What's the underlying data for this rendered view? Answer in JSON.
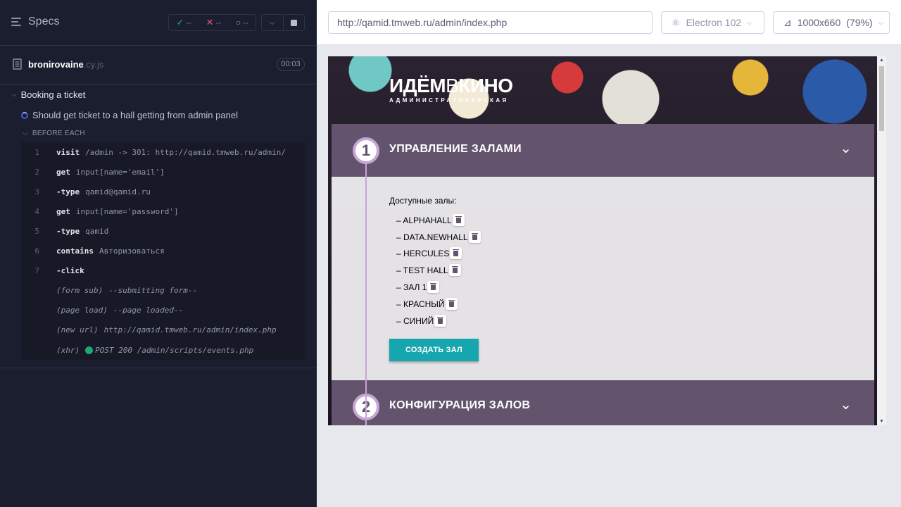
{
  "reporter": {
    "specs_label": "Specs",
    "stats": {
      "passed": "--",
      "failed": "--",
      "pending": "--"
    },
    "file": {
      "name": "bronirovaine",
      "ext": ".cy.js",
      "duration": "00:03"
    },
    "suite": "Booking a ticket",
    "test": "Should get ticket to a hall getting from admin panel",
    "hook": "BEFORE EACH",
    "commands": [
      {
        "num": "1",
        "name": "visit",
        "msg": "/admin -> 301: http://qamid.tmweb.ru/admin/"
      },
      {
        "num": "2",
        "name": "get",
        "msg": "input[name='email']"
      },
      {
        "num": "3",
        "name": "-type",
        "msg": "qamid@qamid.ru"
      },
      {
        "num": "4",
        "name": "get",
        "msg": "input[name='password']"
      },
      {
        "num": "5",
        "name": "-type",
        "msg": "qamid"
      },
      {
        "num": "6",
        "name": "contains",
        "msg": "Авторизоваться"
      },
      {
        "num": "7",
        "name": "-click",
        "msg": ""
      }
    ],
    "events": [
      {
        "name": "(form sub)",
        "msg": "--submitting form--"
      },
      {
        "name": "(page load)",
        "msg": "--page loaded--"
      },
      {
        "name": "(new url)",
        "msg": "http://qamid.tmweb.ru/admin/index.php"
      },
      {
        "name": "(xhr)",
        "msg": "POST 200 /admin/scripts/events.php"
      }
    ]
  },
  "aut": {
    "url": "http://qamid.tmweb.ru/admin/index.php",
    "browser": "Electron 102",
    "viewport": "1000x660",
    "zoom": "(79%)"
  },
  "page": {
    "logo_a": "ИДЁМ",
    "logo_b": "В",
    "logo_c": "КИНО",
    "logo_sub": "АДМИНИСТРАТОРРРСКАЯ",
    "section1": {
      "num": "1",
      "title": "УПРАВЛЕНИЕ ЗАЛАМИ"
    },
    "halls_label": "Доступные залы:",
    "halls": [
      "– ALPHAHALL",
      "– DATA.NEWHALL",
      "– HERCULES",
      "– TEST HALL",
      "– ЗАЛ 1",
      "– КРАСНЫЙ",
      "– СИНИЙ"
    ],
    "create_button": "СОЗДАТЬ ЗАЛ",
    "section2": {
      "num": "2",
      "title": "КОНФИГУРАЦИЯ ЗАЛОВ"
    }
  },
  "colors": {
    "reporter_bg": "#1b1e2e",
    "section_head": "#63536c",
    "accent": "#16a6af",
    "timeline": "#c7a5d6",
    "pass": "#1fa971",
    "fail": "#e45770"
  }
}
